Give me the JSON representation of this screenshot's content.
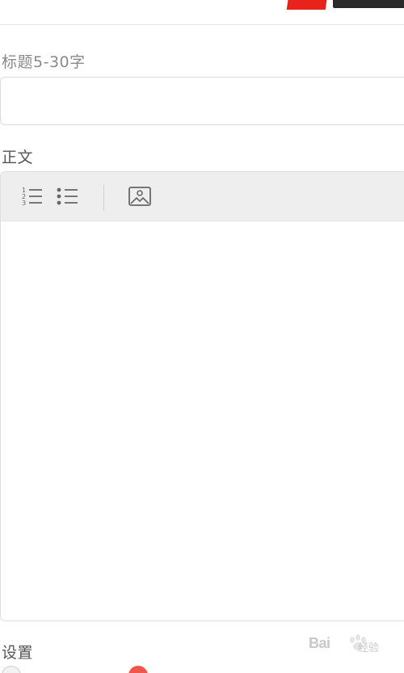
{
  "labels": {
    "title_field": "标题5-30字",
    "body_field": "正文",
    "settings": "设置"
  },
  "title_input": {
    "value": "",
    "placeholder": ""
  },
  "toolbar": {
    "icons": [
      "ordered-list-icon",
      "unordered-list-icon",
      "image-icon"
    ]
  },
  "options": {
    "option_1": {
      "state": "unselected"
    },
    "option_2": {
      "state": "selected"
    }
  },
  "watermark": {
    "brand": "Bai",
    "suffix": "经验"
  },
  "colors": {
    "accent": "#f0574b",
    "label": "#8a8a8a",
    "border": "#dedede",
    "toolbar_bg": "#eeeeee",
    "logo_red": "#e8231b"
  }
}
